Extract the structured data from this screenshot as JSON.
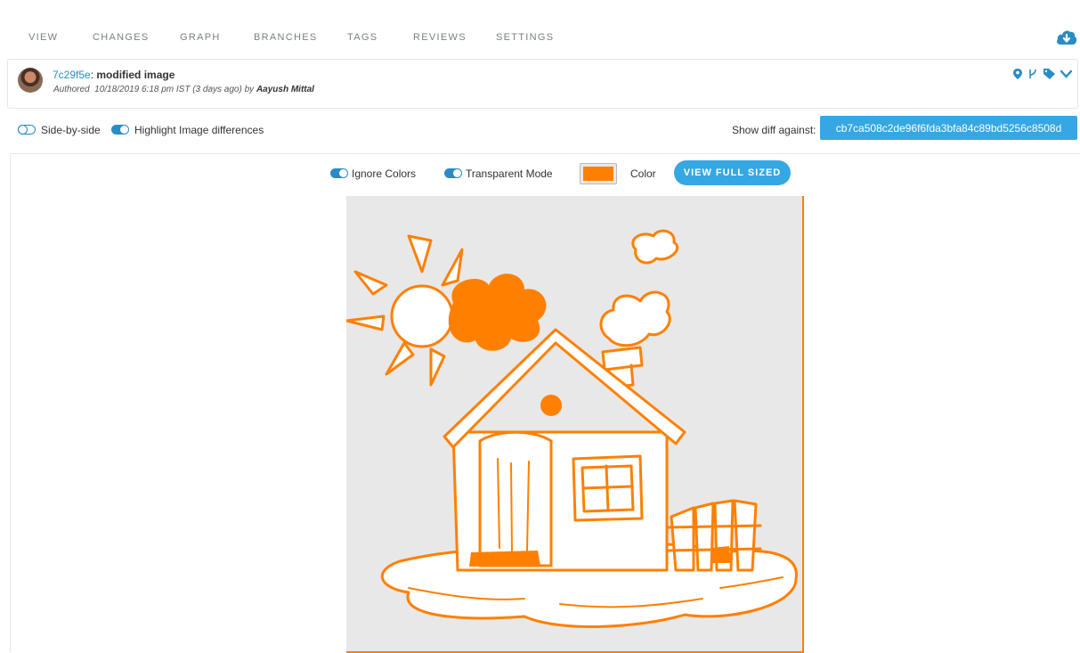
{
  "nav": {
    "tabs": [
      "VIEW",
      "CHANGES",
      "GRAPH",
      "BRANCHES",
      "TAGS",
      "REVIEWS",
      "SETTINGS"
    ],
    "download_icon": "cloud-download-icon"
  },
  "commit": {
    "hash": "7c29f5e",
    "separator": ":",
    "message": "modified image",
    "authored_prefix": "Authored",
    "authored_when": "10/18/2019 6:18 pm IST (3 days ago) by",
    "author": "Aayush Mittal",
    "icons": [
      "map-pin-icon",
      "branch-icon",
      "tag-icon",
      "chevron-down-icon"
    ]
  },
  "options": {
    "side_by_side": "Side-by-side",
    "side_by_side_on": false,
    "highlight": "Highlight Image differences",
    "highlight_on": true,
    "show_diff_label": "Show diff against:",
    "diff_target": "cb7ca508c2de96f6fda3bfa84c89bd5256c8508d"
  },
  "viewer": {
    "ignore_colors": "Ignore Colors",
    "ignore_colors_on": true,
    "transparent_mode": "Transparent Mode",
    "transparent_mode_on": true,
    "color_label": "Color",
    "highlight_color": "#ff8000",
    "view_full_sized": "VIEW FULL SIZED"
  },
  "colors": {
    "accent": "#35a7e3",
    "link": "#2a8cc4",
    "diff_highlight": "#ff8000",
    "image_bg": "#e8e8e8"
  }
}
